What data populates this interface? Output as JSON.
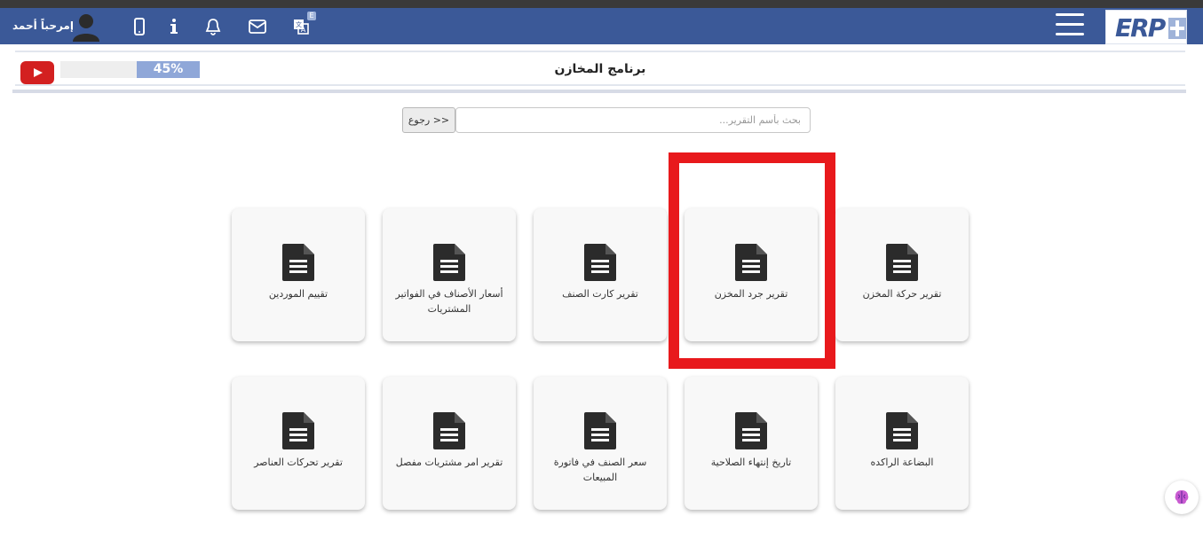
{
  "navbar": {
    "welcome": "إمرحباً أحمد",
    "icons": [
      "user-avatar",
      "mobile-icon",
      "info-icon",
      "bell-icon",
      "mail-icon",
      "translate-icon",
      "menu-icon"
    ],
    "translate_badge": "E",
    "logo_text": "ERP",
    "bg_color": "#3b5998"
  },
  "header": {
    "title": "برنامج المخازن",
    "progress_label": "45%",
    "progress_value": 0.45
  },
  "search": {
    "placeholder": "بحث بأسم التقرير...",
    "back_label": "<< رجوع"
  },
  "reports": [
    {
      "label": "تقرير حركة المخزن"
    },
    {
      "label": "تقرير جرد المخزن"
    },
    {
      "label": "تقرير كارت الصنف"
    },
    {
      "label": "أسعار الأصناف في الفواتير المشتريات"
    },
    {
      "label": "تقييم الموردين"
    },
    {
      "label": "البضاعة الراكده"
    },
    {
      "label": "تاريخ إنتهاء الصلاحية"
    },
    {
      "label": "سعر الصنف في فاتورة المبيعات"
    },
    {
      "label": "تقرير امر مشتريات مفصل"
    },
    {
      "label": "تقرير تحركات العناصر"
    }
  ],
  "highlighted_report": 1,
  "colors": {
    "highlight": "#e8191c",
    "accent": "#3b5998"
  }
}
